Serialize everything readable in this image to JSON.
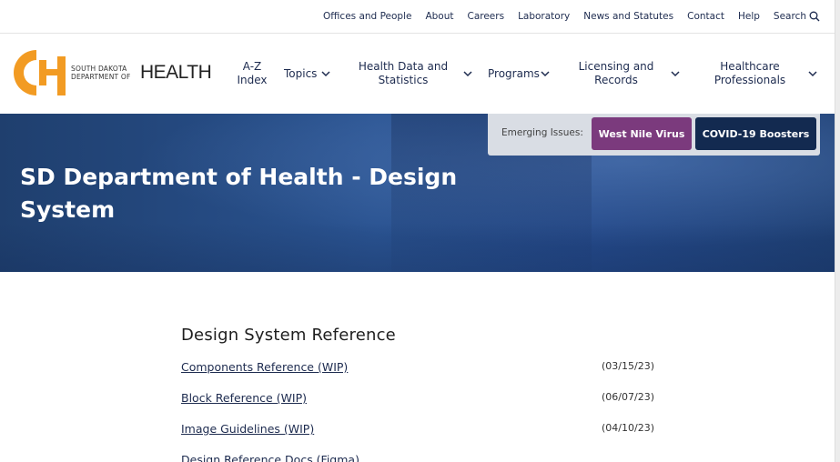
{
  "utility_nav": [
    "Offices and People",
    "About",
    "Careers",
    "Laboratory",
    "News and Statutes",
    "Contact",
    "Help"
  ],
  "search_label": "Search",
  "logo": {
    "line1": "SOUTH DAKOTA",
    "line2": "DEPARTMENT OF",
    "word": "HEALTH"
  },
  "main_nav": {
    "az_line1": "A-Z",
    "az_line2": "Index",
    "topics": "Topics",
    "hds_line1": "Health Data and",
    "hds_line2": "Statistics",
    "programs": "Programs",
    "lr_line1": "Licensing and",
    "lr_line2": "Records",
    "hp_line1": "Healthcare",
    "hp_line2": "Professionals"
  },
  "emerging": {
    "label": "Emerging Issues:",
    "btn1": "West Nile Virus",
    "btn2": "COVID-19 Boosters"
  },
  "hero": {
    "title": "SD Department of Health - Design System"
  },
  "section": {
    "heading": "Design System Reference",
    "links": [
      {
        "label": "Components Reference (WIP)",
        "date": "(03/15/23)"
      },
      {
        "label": "Block Reference (WIP)",
        "date": "(06/07/23)"
      },
      {
        "label": "Image Guidelines (WIP)",
        "date": "(04/10/23)"
      },
      {
        "label": "Design Reference Docs (Figma)",
        "date": ""
      }
    ]
  },
  "colors": {
    "navy": "#1d2b4f",
    "orange": "#f29b23",
    "purple": "#7b3a7d",
    "dark_navy": "#132a50"
  }
}
